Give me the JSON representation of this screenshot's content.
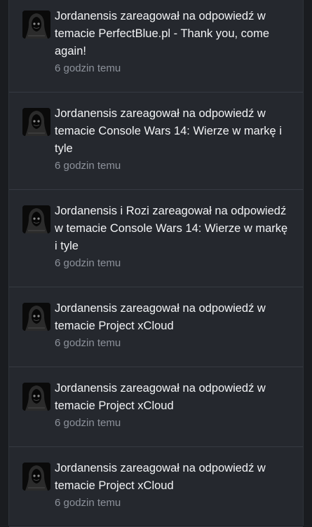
{
  "notifications": [
    {
      "text": "Jordanensis zareagował na odpowiedź w temacie PerfectBlue.pl - Thank you, come again!",
      "time": "6 godzin temu",
      "avatar_icon": "hooded-figure-icon"
    },
    {
      "text": "Jordanensis zareagował na odpowiedź w temacie Console Wars 14: Wierze w markę i tyle",
      "time": "6 godzin temu",
      "avatar_icon": "hooded-figure-icon"
    },
    {
      "text": "Jordanensis i Rozi zareagował na odpowiedź w temacie Console Wars 14: Wierze w markę i tyle",
      "time": "6 godzin temu",
      "avatar_icon": "hooded-figure-icon"
    },
    {
      "text": "Jordanensis zareagował na odpowiedź w temacie Project xCloud",
      "time": "6 godzin temu",
      "avatar_icon": "hooded-figure-icon"
    },
    {
      "text": "Jordanensis zareagował na odpowiedź w temacie Project xCloud",
      "time": "6 godzin temu",
      "avatar_icon": "hooded-figure-icon"
    },
    {
      "text": "Jordanensis zareagował na odpowiedź w temacie Project xCloud",
      "time": "6 godzin temu",
      "avatar_icon": "hooded-figure-icon"
    }
  ],
  "colors": {
    "background": "#1c1e22",
    "card": "#25282e",
    "text": "#f2f3f5",
    "muted": "#8d929b",
    "divider": "#363a42"
  }
}
